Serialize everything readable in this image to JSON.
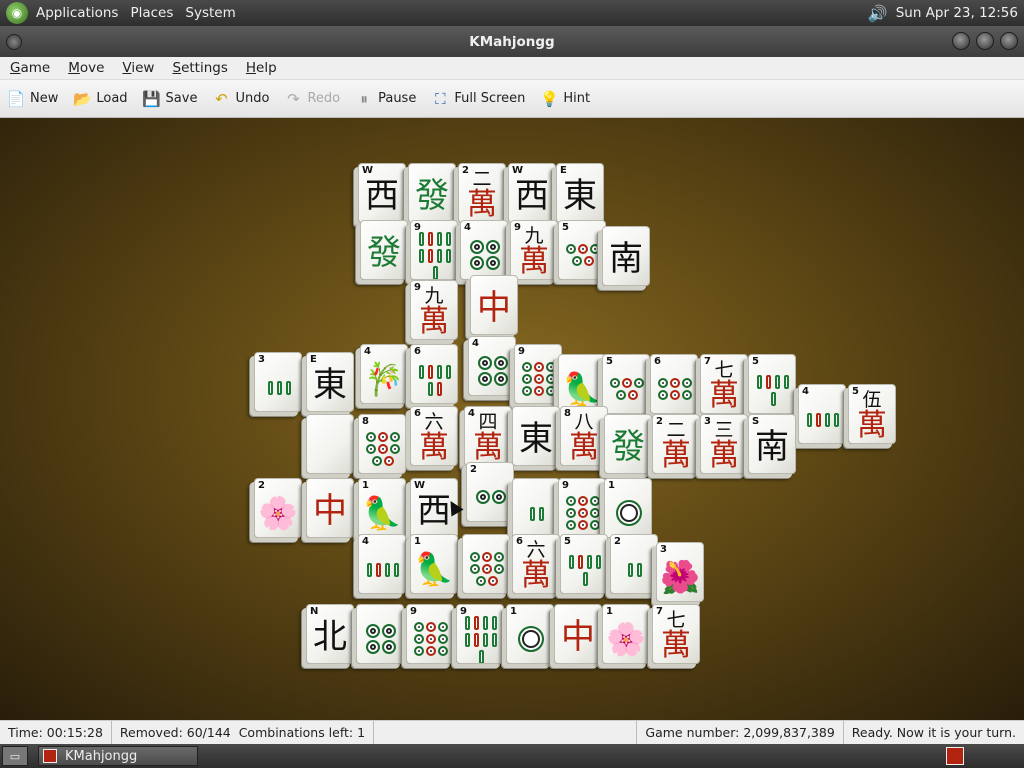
{
  "top_panel": {
    "menus": [
      "Applications",
      "Places",
      "System"
    ],
    "clock": "Sun Apr 23, 12:56"
  },
  "window": {
    "title": "KMahjongg"
  },
  "menubar": [
    "Game",
    "Move",
    "View",
    "Settings",
    "Help"
  ],
  "toolbar": [
    {
      "label": "New",
      "icon": "new-icon",
      "disabled": false
    },
    {
      "label": "Load",
      "icon": "load-icon",
      "disabled": false
    },
    {
      "label": "Save",
      "icon": "save-icon",
      "disabled": false
    },
    {
      "label": "Undo",
      "icon": "undo-icon",
      "disabled": false
    },
    {
      "label": "Redo",
      "icon": "redo-icon",
      "disabled": true
    },
    {
      "label": "Pause",
      "icon": "pause-icon",
      "disabled": false
    },
    {
      "label": "Full Screen",
      "icon": "fullscreen-icon",
      "disabled": false
    },
    {
      "label": "Hint",
      "icon": "hint-icon",
      "disabled": false
    }
  ],
  "tiles": [
    {
      "label": "W",
      "kind": "char",
      "glyph": "西",
      "color": "black"
    },
    {
      "label": "",
      "kind": "char",
      "glyph": "發",
      "color": "green"
    },
    {
      "label": "2",
      "kind": "man",
      "num": "二",
      "glyph": "萬"
    },
    {
      "label": "W",
      "kind": "char",
      "glyph": "西",
      "color": "black"
    },
    {
      "label": "E",
      "kind": "char",
      "glyph": "東",
      "color": "black"
    },
    {
      "label": "",
      "kind": "char",
      "glyph": "發",
      "color": "green"
    },
    {
      "label": "9",
      "kind": "bam",
      "count": 9
    },
    {
      "label": "4",
      "kind": "dot",
      "count": 4
    },
    {
      "label": "9",
      "kind": "man",
      "num": "九",
      "glyph": "萬"
    },
    {
      "label": "5",
      "kind": "dot",
      "count": 5
    },
    {
      "label": "",
      "kind": "char",
      "glyph": "南",
      "color": "black"
    },
    {
      "label": "9",
      "kind": "man",
      "num": "九",
      "glyph": "萬"
    },
    {
      "label": "",
      "kind": "char",
      "glyph": "中",
      "color": "red"
    },
    {
      "label": "4",
      "kind": "dot",
      "count": 4
    },
    {
      "label": "3",
      "kind": "bam",
      "count": 3
    },
    {
      "label": "E",
      "kind": "char",
      "glyph": "東",
      "color": "black"
    },
    {
      "label": "4",
      "kind": "pic",
      "glyph": "🎋"
    },
    {
      "label": "6",
      "kind": "bam",
      "count": 6
    },
    {
      "label": "9",
      "kind": "dot",
      "count": 9
    },
    {
      "label": "",
      "kind": "pic",
      "glyph": "🦜"
    },
    {
      "label": "5",
      "kind": "dot",
      "count": 5
    },
    {
      "label": "6",
      "kind": "dot",
      "count": 6
    },
    {
      "label": "7",
      "kind": "man",
      "num": "七",
      "glyph": "萬"
    },
    {
      "label": "5",
      "kind": "bam",
      "count": 5
    },
    {
      "label": "4",
      "kind": "bam",
      "count": 4
    },
    {
      "label": "5",
      "kind": "man",
      "num": "伍",
      "glyph": "萬"
    },
    {
      "label": "",
      "kind": "blank"
    },
    {
      "label": "8",
      "kind": "dot",
      "count": 8
    },
    {
      "label": "6",
      "kind": "man",
      "num": "六",
      "glyph": "萬"
    },
    {
      "label": "4",
      "kind": "man",
      "num": "四",
      "glyph": "萬"
    },
    {
      "label": "",
      "kind": "char",
      "glyph": "東",
      "color": "black"
    },
    {
      "label": "8",
      "kind": "man",
      "num": "八",
      "glyph": "萬"
    },
    {
      "label": "",
      "kind": "char",
      "glyph": "發",
      "color": "green"
    },
    {
      "label": "2",
      "kind": "man",
      "num": "二",
      "glyph": "萬"
    },
    {
      "label": "3",
      "kind": "man",
      "num": "三",
      "glyph": "萬"
    },
    {
      "label": "S",
      "kind": "char",
      "glyph": "南",
      "color": "black"
    },
    {
      "label": "2",
      "kind": "pic",
      "glyph": "🌸"
    },
    {
      "label": "",
      "kind": "char",
      "glyph": "中",
      "color": "red"
    },
    {
      "label": "1",
      "kind": "pic",
      "glyph": "🦜"
    },
    {
      "label": "W",
      "kind": "char",
      "glyph": "西",
      "color": "black"
    },
    {
      "label": "2",
      "kind": "dot",
      "count": 2
    },
    {
      "label": "",
      "kind": "bam",
      "count": 2
    },
    {
      "label": "9",
      "kind": "dot",
      "count": 9
    },
    {
      "label": "1",
      "kind": "dot",
      "count": 1
    },
    {
      "label": "4",
      "kind": "bam",
      "count": 4
    },
    {
      "label": "1",
      "kind": "pic",
      "glyph": "🦜"
    },
    {
      "label": "",
      "kind": "dot",
      "count": 8
    },
    {
      "label": "6",
      "kind": "man",
      "num": "六",
      "glyph": "萬"
    },
    {
      "label": "5",
      "kind": "bam",
      "count": 5
    },
    {
      "label": "2",
      "kind": "bam",
      "count": 2
    },
    {
      "label": "3",
      "kind": "pic",
      "glyph": "🌺"
    },
    {
      "label": "N",
      "kind": "char",
      "glyph": "北",
      "color": "black"
    },
    {
      "label": "",
      "kind": "dot",
      "count": 4
    },
    {
      "label": "9",
      "kind": "dot",
      "count": 9
    },
    {
      "label": "9",
      "kind": "bam",
      "count": 9
    },
    {
      "label": "1",
      "kind": "dot",
      "count": 1
    },
    {
      "label": "",
      "kind": "char",
      "glyph": "中",
      "color": "red"
    },
    {
      "label": "1",
      "kind": "pic",
      "glyph": "🌸"
    },
    {
      "label": "7",
      "kind": "man",
      "num": "七",
      "glyph": "萬"
    }
  ],
  "statusbar": {
    "time": "Time: 00:15:28",
    "removed": "Removed: 60/144",
    "combinations": "Combinations left: 1",
    "game_number": "Game number: 2,099,837,389",
    "message": "Ready. Now it is your turn."
  },
  "taskbar": {
    "task_label": "KMahjongg"
  },
  "colors": {
    "board": "#6b5218",
    "tile_red": "#b2240f",
    "tile_green": "#1b7a34"
  }
}
